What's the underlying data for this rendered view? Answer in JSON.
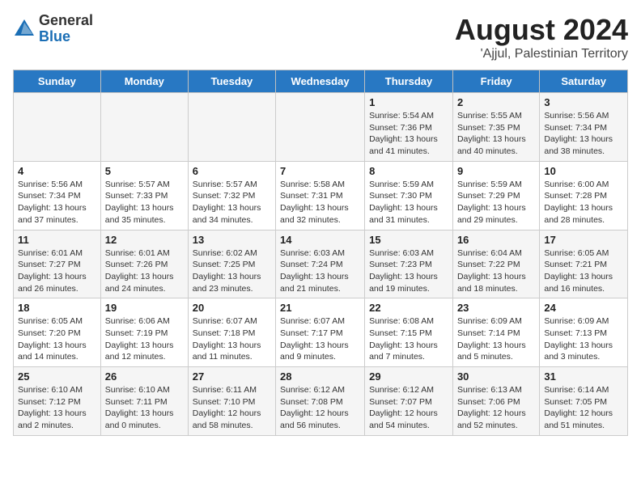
{
  "logo": {
    "general": "General",
    "blue": "Blue"
  },
  "title": "August 2024",
  "subtitle": "'Ajjul, Palestinian Territory",
  "days_of_week": [
    "Sunday",
    "Monday",
    "Tuesday",
    "Wednesday",
    "Thursday",
    "Friday",
    "Saturday"
  ],
  "weeks": [
    [
      {
        "day": "",
        "info": ""
      },
      {
        "day": "",
        "info": ""
      },
      {
        "day": "",
        "info": ""
      },
      {
        "day": "",
        "info": ""
      },
      {
        "day": "1",
        "info": "Sunrise: 5:54 AM\nSunset: 7:36 PM\nDaylight: 13 hours and 41 minutes."
      },
      {
        "day": "2",
        "info": "Sunrise: 5:55 AM\nSunset: 7:35 PM\nDaylight: 13 hours and 40 minutes."
      },
      {
        "day": "3",
        "info": "Sunrise: 5:56 AM\nSunset: 7:34 PM\nDaylight: 13 hours and 38 minutes."
      }
    ],
    [
      {
        "day": "4",
        "info": "Sunrise: 5:56 AM\nSunset: 7:34 PM\nDaylight: 13 hours and 37 minutes."
      },
      {
        "day": "5",
        "info": "Sunrise: 5:57 AM\nSunset: 7:33 PM\nDaylight: 13 hours and 35 minutes."
      },
      {
        "day": "6",
        "info": "Sunrise: 5:57 AM\nSunset: 7:32 PM\nDaylight: 13 hours and 34 minutes."
      },
      {
        "day": "7",
        "info": "Sunrise: 5:58 AM\nSunset: 7:31 PM\nDaylight: 13 hours and 32 minutes."
      },
      {
        "day": "8",
        "info": "Sunrise: 5:59 AM\nSunset: 7:30 PM\nDaylight: 13 hours and 31 minutes."
      },
      {
        "day": "9",
        "info": "Sunrise: 5:59 AM\nSunset: 7:29 PM\nDaylight: 13 hours and 29 minutes."
      },
      {
        "day": "10",
        "info": "Sunrise: 6:00 AM\nSunset: 7:28 PM\nDaylight: 13 hours and 28 minutes."
      }
    ],
    [
      {
        "day": "11",
        "info": "Sunrise: 6:01 AM\nSunset: 7:27 PM\nDaylight: 13 hours and 26 minutes."
      },
      {
        "day": "12",
        "info": "Sunrise: 6:01 AM\nSunset: 7:26 PM\nDaylight: 13 hours and 24 minutes."
      },
      {
        "day": "13",
        "info": "Sunrise: 6:02 AM\nSunset: 7:25 PM\nDaylight: 13 hours and 23 minutes."
      },
      {
        "day": "14",
        "info": "Sunrise: 6:03 AM\nSunset: 7:24 PM\nDaylight: 13 hours and 21 minutes."
      },
      {
        "day": "15",
        "info": "Sunrise: 6:03 AM\nSunset: 7:23 PM\nDaylight: 13 hours and 19 minutes."
      },
      {
        "day": "16",
        "info": "Sunrise: 6:04 AM\nSunset: 7:22 PM\nDaylight: 13 hours and 18 minutes."
      },
      {
        "day": "17",
        "info": "Sunrise: 6:05 AM\nSunset: 7:21 PM\nDaylight: 13 hours and 16 minutes."
      }
    ],
    [
      {
        "day": "18",
        "info": "Sunrise: 6:05 AM\nSunset: 7:20 PM\nDaylight: 13 hours and 14 minutes."
      },
      {
        "day": "19",
        "info": "Sunrise: 6:06 AM\nSunset: 7:19 PM\nDaylight: 13 hours and 12 minutes."
      },
      {
        "day": "20",
        "info": "Sunrise: 6:07 AM\nSunset: 7:18 PM\nDaylight: 13 hours and 11 minutes."
      },
      {
        "day": "21",
        "info": "Sunrise: 6:07 AM\nSunset: 7:17 PM\nDaylight: 13 hours and 9 minutes."
      },
      {
        "day": "22",
        "info": "Sunrise: 6:08 AM\nSunset: 7:15 PM\nDaylight: 13 hours and 7 minutes."
      },
      {
        "day": "23",
        "info": "Sunrise: 6:09 AM\nSunset: 7:14 PM\nDaylight: 13 hours and 5 minutes."
      },
      {
        "day": "24",
        "info": "Sunrise: 6:09 AM\nSunset: 7:13 PM\nDaylight: 13 hours and 3 minutes."
      }
    ],
    [
      {
        "day": "25",
        "info": "Sunrise: 6:10 AM\nSunset: 7:12 PM\nDaylight: 13 hours and 2 minutes."
      },
      {
        "day": "26",
        "info": "Sunrise: 6:10 AM\nSunset: 7:11 PM\nDaylight: 13 hours and 0 minutes."
      },
      {
        "day": "27",
        "info": "Sunrise: 6:11 AM\nSunset: 7:10 PM\nDaylight: 12 hours and 58 minutes."
      },
      {
        "day": "28",
        "info": "Sunrise: 6:12 AM\nSunset: 7:08 PM\nDaylight: 12 hours and 56 minutes."
      },
      {
        "day": "29",
        "info": "Sunrise: 6:12 AM\nSunset: 7:07 PM\nDaylight: 12 hours and 54 minutes."
      },
      {
        "day": "30",
        "info": "Sunrise: 6:13 AM\nSunset: 7:06 PM\nDaylight: 12 hours and 52 minutes."
      },
      {
        "day": "31",
        "info": "Sunrise: 6:14 AM\nSunset: 7:05 PM\nDaylight: 12 hours and 51 minutes."
      }
    ]
  ]
}
